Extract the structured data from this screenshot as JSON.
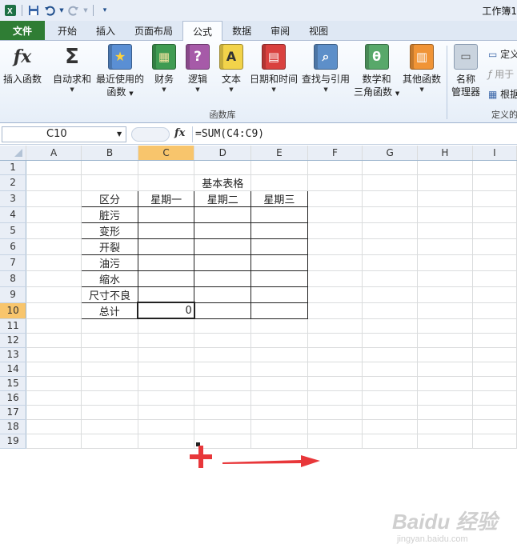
{
  "window_title": "工作簿1",
  "qat": {
    "save_icon": "save-icon",
    "undo_icon": "undo-icon",
    "redo_icon": "redo-icon",
    "customize_icon": "customize-qat-icon"
  },
  "tabs": [
    {
      "label": "文件"
    },
    {
      "label": "开始"
    },
    {
      "label": "插入"
    },
    {
      "label": "页面布局"
    },
    {
      "label": "公式",
      "active": true
    },
    {
      "label": "数据"
    },
    {
      "label": "审阅"
    },
    {
      "label": "视图"
    }
  ],
  "ribbon": {
    "insert_function": {
      "label": "插入函数",
      "glyph": "fx"
    },
    "autosum": {
      "label": "自动求和",
      "glyph": "Σ"
    },
    "recent": {
      "label1": "最近使用的",
      "label2": "函数"
    },
    "financial": {
      "label": "财务"
    },
    "logical": {
      "label": "逻辑",
      "glyph": "?"
    },
    "text": {
      "label": "文本",
      "glyph": "A"
    },
    "datetime": {
      "label": "日期和时间"
    },
    "lookup": {
      "label": "查找与引用"
    },
    "mathtrig": {
      "label1": "数学和",
      "label2": "三角函数",
      "glyph": "θ"
    },
    "more": {
      "label": "其他函数"
    },
    "name_manager": {
      "label1": "名称",
      "label2": "管理器"
    },
    "define_name": "定义",
    "use_in_formula": "用于",
    "create_from_selection": "根据",
    "group_label": "函数库",
    "define_group_label": "定义的"
  },
  "formula_bar": {
    "name_box": "C10",
    "fx": "fx",
    "formula": "=SUM(C4:C9)"
  },
  "grid": {
    "columns": [
      "A",
      "B",
      "C",
      "D",
      "E",
      "F",
      "G",
      "H",
      "I"
    ],
    "rows": [
      "1",
      "2",
      "3",
      "4",
      "5",
      "6",
      "7",
      "8",
      "9",
      "10",
      "11",
      "12",
      "13",
      "14",
      "15",
      "16",
      "17",
      "18",
      "19"
    ],
    "selected_cell": "C10",
    "cells": {
      "D2": "基本表格",
      "B3": "区分",
      "C3": "星期一",
      "D3": "星期二",
      "E3": "星期三",
      "B4": "脏污",
      "B5": "变形",
      "B6": "开裂",
      "B7": "油污",
      "B8": "缩水",
      "B9": "尺寸不良",
      "B10": "总计",
      "C10": "0"
    }
  },
  "annotations": {
    "plus_color": "#e8373a",
    "arrow_color": "#e8373a"
  },
  "watermark": {
    "text": "Baidu 经验",
    "sub": "jingyan.baidu.com"
  }
}
